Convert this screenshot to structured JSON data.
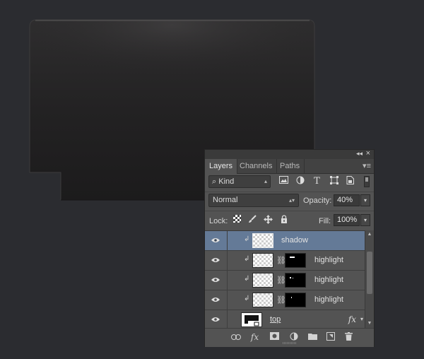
{
  "panel": {
    "tabs": [
      "Layers",
      "Channels",
      "Paths"
    ],
    "collapse_glyph": "◂◂",
    "close_glyph": "×",
    "menu_glyph": "▾≡",
    "filter": {
      "search_icon": "search-icon",
      "kind_label": "Kind"
    },
    "filter_icons": [
      "image-filter-icon",
      "adjustment-filter-icon",
      "type-filter-icon",
      "shape-filter-icon",
      "smart-object-filter-icon"
    ],
    "blend_mode": "Normal",
    "opacity_label": "Opacity:",
    "opacity_value": "40%",
    "lock_label": "Lock:",
    "lock_icons": [
      "lock-transparent-icon",
      "lock-image-icon",
      "lock-position-icon",
      "lock-all-icon"
    ],
    "fill_label": "Fill:",
    "fill_value": "100%",
    "layers": [
      {
        "name": "shadow",
        "selected": true,
        "clipped": true,
        "has_mask": false
      },
      {
        "name": "highlight",
        "selected": false,
        "clipped": true,
        "has_mask": true
      },
      {
        "name": "highlight",
        "selected": false,
        "clipped": true,
        "has_mask": true
      },
      {
        "name": "highlight",
        "selected": false,
        "clipped": true,
        "has_mask": true
      },
      {
        "name": "top",
        "selected": false,
        "clipped": false,
        "has_mask": false,
        "fx": "fx"
      }
    ],
    "bottom_icons": [
      "link-layers-icon",
      "fx-icon",
      "add-mask-icon",
      "adjustment-layer-icon",
      "new-group-icon",
      "new-layer-icon",
      "delete-icon"
    ],
    "bottom_fx_label": "fx"
  },
  "colors": {
    "background": "#2b2c30",
    "panel": "#535353",
    "selected_layer": "#647a97"
  }
}
